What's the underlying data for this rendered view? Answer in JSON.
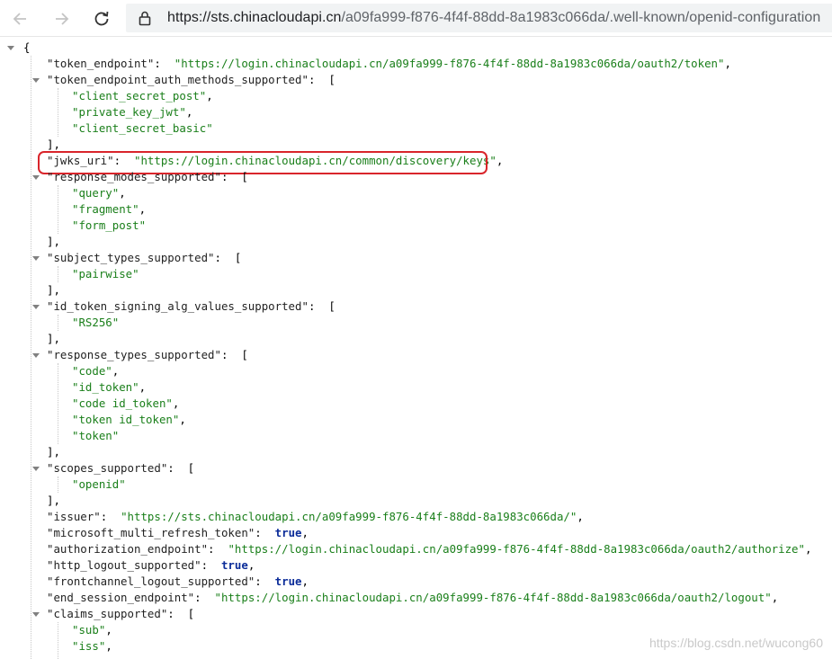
{
  "browser": {
    "url_host": "https://sts.chinacloudapi.cn",
    "url_path": "/a09fa999-f876-4f4f-88dd-8a1983c066da/.well-known/openid-configuration"
  },
  "json": {
    "open_brace": "{",
    "token_endpoint": {
      "key": "\"token_endpoint\"",
      "value": "\"https://login.chinacloudapi.cn/a09fa999-f876-4f4f-88dd-8a1983c066da/oauth2/token\""
    },
    "token_endpoint_auth_methods_supported": {
      "key": "\"token_endpoint_auth_methods_supported\"",
      "items": [
        "\"client_secret_post\"",
        "\"private_key_jwt\"",
        "\"client_secret_basic\""
      ]
    },
    "jwks_uri": {
      "key": "\"jwks_uri\"",
      "value": "\"https://login.chinacloudapi.cn/common/discovery/keys\""
    },
    "response_modes_supported": {
      "key": "\"response_modes_supported\"",
      "items": [
        "\"query\"",
        "\"fragment\"",
        "\"form_post\""
      ]
    },
    "subject_types_supported": {
      "key": "\"subject_types_supported\"",
      "items": [
        "\"pairwise\""
      ]
    },
    "id_token_signing_alg_values_supported": {
      "key": "\"id_token_signing_alg_values_supported\"",
      "items": [
        "\"RS256\""
      ]
    },
    "response_types_supported": {
      "key": "\"response_types_supported\"",
      "items": [
        "\"code\"",
        "\"id_token\"",
        "\"code id_token\"",
        "\"token id_token\"",
        "\"token\""
      ]
    },
    "scopes_supported": {
      "key": "\"scopes_supported\"",
      "items": [
        "\"openid\""
      ]
    },
    "issuer": {
      "key": "\"issuer\"",
      "value": "\"https://sts.chinacloudapi.cn/a09fa999-f876-4f4f-88dd-8a1983c066da/\""
    },
    "microsoft_multi_refresh_token": {
      "key": "\"microsoft_multi_refresh_token\"",
      "value": "true"
    },
    "authorization_endpoint": {
      "key": "\"authorization_endpoint\"",
      "value": "\"https://login.chinacloudapi.cn/a09fa999-f876-4f4f-88dd-8a1983c066da/oauth2/authorize\""
    },
    "http_logout_supported": {
      "key": "\"http_logout_supported\"",
      "value": "true"
    },
    "frontchannel_logout_supported": {
      "key": "\"frontchannel_logout_supported\"",
      "value": "true"
    },
    "end_session_endpoint": {
      "key": "\"end_session_endpoint\"",
      "value": "\"https://login.chinacloudapi.cn/a09fa999-f876-4f4f-88dd-8a1983c066da/oauth2/logout\""
    },
    "claims_supported": {
      "key": "\"claims_supported\"",
      "items": [
        "\"sub\"",
        "\"iss\""
      ]
    }
  },
  "watermark": "https://blog.csdn.net/wucong60",
  "colors": {
    "highlight": "#d9252b",
    "string": "#1a7f1a",
    "boolean": "#0b2c99"
  }
}
